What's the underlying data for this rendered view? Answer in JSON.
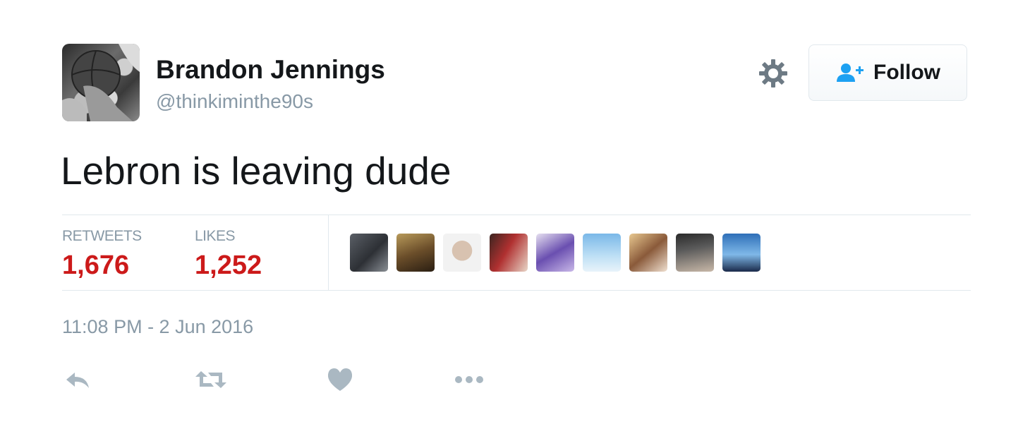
{
  "user": {
    "display_name": "Brandon Jennings",
    "screen_name": "@thinkiminthe90s",
    "avatar_icon": "profile-photo-basketball"
  },
  "header": {
    "settings_icon": "gear-icon",
    "follow_label": "Follow",
    "follow_icon": "add-user-icon"
  },
  "tweet": {
    "text": "Lebron is leaving dude",
    "timestamp": "11:08 PM - 2 Jun 2016"
  },
  "stats": {
    "retweets_label": "RETWEETS",
    "retweets_count": "1,676",
    "likes_label": "LIKES",
    "likes_count": "1,252"
  },
  "likers": [
    {
      "icon": "liker-avatar"
    },
    {
      "icon": "liker-avatar"
    },
    {
      "icon": "liker-avatar"
    },
    {
      "icon": "liker-avatar"
    },
    {
      "icon": "liker-avatar"
    },
    {
      "icon": "liker-avatar"
    },
    {
      "icon": "liker-avatar"
    },
    {
      "icon": "liker-avatar"
    },
    {
      "icon": "liker-avatar"
    }
  ],
  "actions": {
    "reply_icon": "reply-icon",
    "retweet_icon": "retweet-icon",
    "like_icon": "heart-icon",
    "more_icon": "more-dots-icon"
  },
  "colors": {
    "count_red": "#cc1a1a",
    "muted_gray": "#8899a6",
    "follow_blue": "#1da1f2",
    "divider": "#e1e8ed"
  }
}
